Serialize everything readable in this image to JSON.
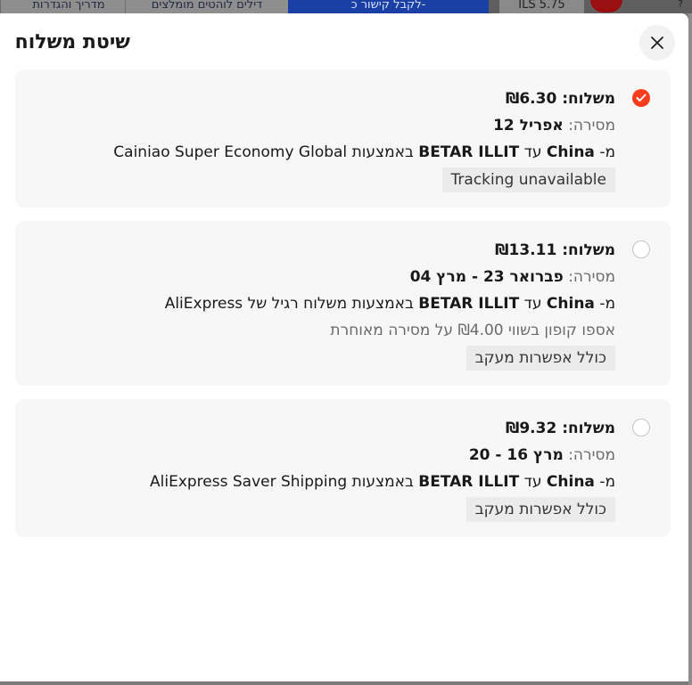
{
  "background": {
    "tabs": [
      "מדריך והגדרות",
      "דילים לוהטים מומלצים"
    ],
    "blue_button": "לקבל קישור כ-",
    "price": "ILS 5.75",
    "help": "?"
  },
  "modal": {
    "title": "שיטת משלוח",
    "close_icon": "close-icon",
    "options": [
      {
        "selected": true,
        "shipping_label": "משלוח:",
        "shipping_price": "₪6.30",
        "delivery_label": "מסירה:",
        "delivery_date": "אפריל 12",
        "from_label": "מ-",
        "from": "China",
        "to_label": "עד",
        "to": "BETAR ILLIT",
        "via_label": "באמצעות",
        "carrier": "Cainiao Super Economy Global",
        "coupon_note": "",
        "tracking": "Tracking unavailable"
      },
      {
        "selected": false,
        "shipping_label": "משלוח:",
        "shipping_price": "₪13.11",
        "delivery_label": "מסירה:",
        "delivery_date": "פברואר 23 - מרץ 04",
        "from_label": "מ-",
        "from": "China",
        "to_label": "עד",
        "to": "BETAR ILLIT",
        "via_label": "באמצעות",
        "carrier": "משלוח רגיל של AliExpress",
        "coupon_note": "אספו קופון בשווי ₪4.00 על מסירה מאוחרת",
        "tracking": "כולל אפשרות מעקב"
      },
      {
        "selected": false,
        "shipping_label": "משלוח:",
        "shipping_price": "₪9.32",
        "delivery_label": "מסירה:",
        "delivery_date": "מרץ 16 - 20",
        "from_label": "מ-",
        "from": "China",
        "to_label": "עד",
        "to": "BETAR ILLIT",
        "via_label": "באמצעות",
        "carrier": "AliExpress Saver Shipping",
        "coupon_note": "",
        "tracking": "כולל אפשרות מעקב"
      }
    ]
  },
  "colors": {
    "accent": "#fd3b1d",
    "card_bg": "#f7f7f7",
    "tag_bg": "#ebebeb"
  }
}
